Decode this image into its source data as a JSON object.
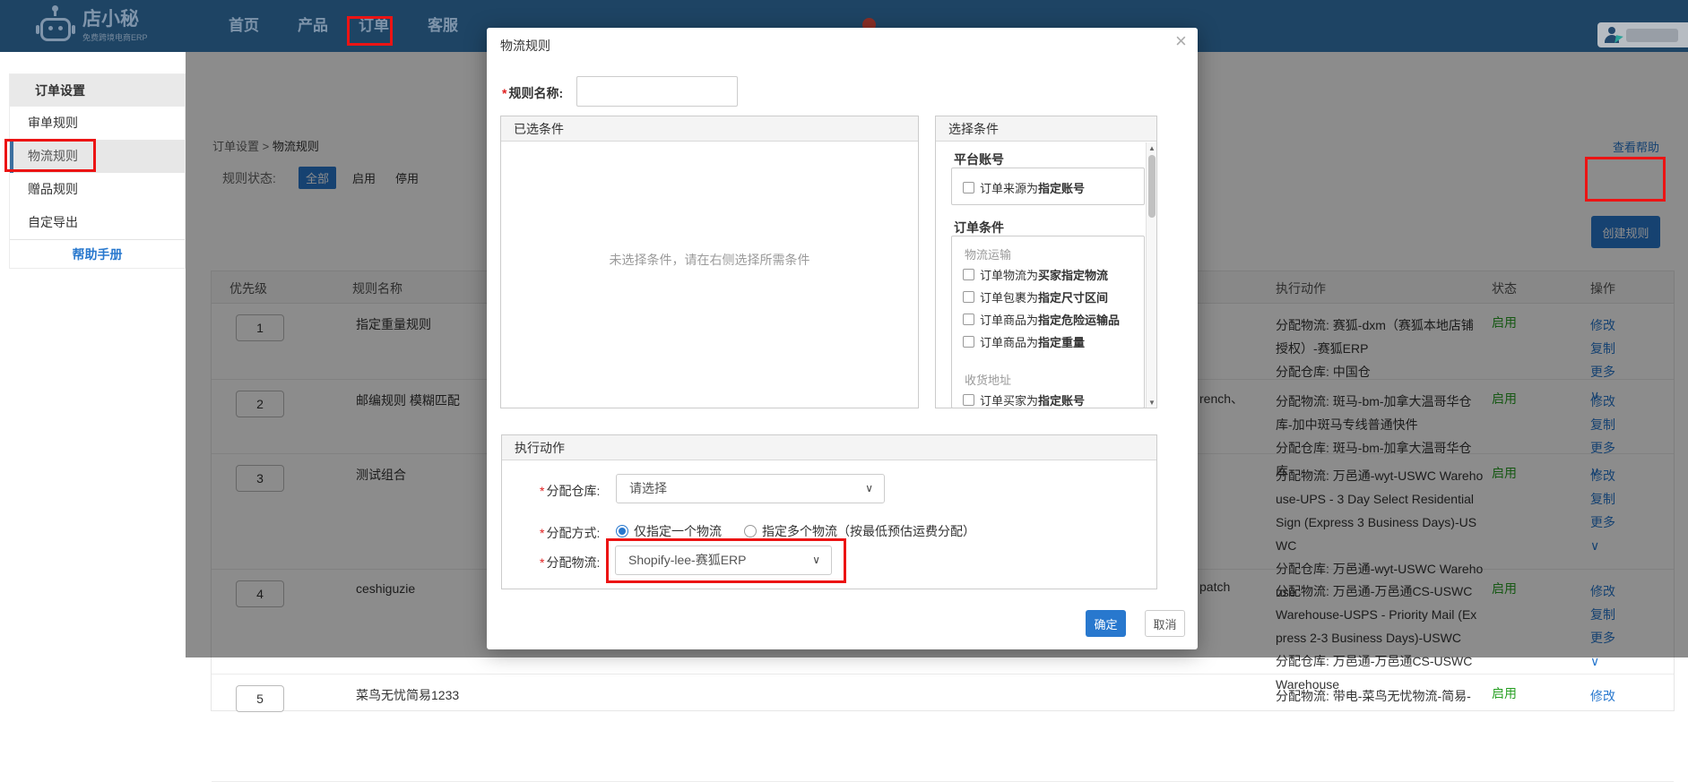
{
  "nav": {
    "logo_title": "店小秘",
    "logo_subtitle": "免费跨境电商ERP",
    "items": [
      "首页",
      "产品",
      "订单",
      "客服"
    ]
  },
  "sidebar": {
    "title": "订单设置",
    "items": [
      "审单规则",
      "物流规则",
      "赠品规则",
      "自定导出"
    ],
    "help_link": "帮助手册"
  },
  "content": {
    "breadcrumb": {
      "parent": "订单设置",
      "separator": ">",
      "current": "物流规则"
    },
    "help_link": "查看帮助",
    "filter": {
      "label": "规则状态:",
      "options": [
        "全部",
        "启用",
        "停用"
      ]
    },
    "create_button": "创建规则",
    "table": {
      "headers": [
        "优先级",
        "规则名称",
        "执行动作",
        "状态",
        "操作"
      ],
      "op_labels": {
        "edit": "修改",
        "copy": "复制",
        "more": "更多",
        "more_chevron": "∨"
      },
      "rows": [
        {
          "priority": "1",
          "name": "指定重量规则",
          "fragment": "",
          "action": "分配物流: 赛狐-dxm（赛狐本地店铺授权）-赛狐ERP\n分配仓库: 中国仓",
          "status": "启用"
        },
        {
          "priority": "2",
          "name": "邮编规则 模糊匹配",
          "fragment": "rench、",
          "action": "分配物流: 斑马-bm-加拿大温哥华仓库-加中斑马专线普通快件\n分配仓库: 斑马-bm-加拿大温哥华仓库",
          "status": "启用"
        },
        {
          "priority": "3",
          "name": "测试组合",
          "fragment": "",
          "action": "分配物流: 万邑通-wyt-USWC Warehouse-UPS - 3 Day Select Residential Sign (Express 3 Business Days)-USWC\n分配仓库: 万邑通-wyt-USWC Warehouse",
          "status": "启用"
        },
        {
          "priority": "4",
          "name": "ceshiguzie",
          "fragment": "patch",
          "action": "分配物流: 万邑通-万邑通CS-USWC Warehouse-USPS - Priority Mail (Express 2-3 Business Days)-USWC\n分配仓库: 万邑通-万邑通CS-USWC Warehouse",
          "status": "启用"
        },
        {
          "priority": "5",
          "name": "菜鸟无忧简易1233",
          "fragment": "",
          "action": "分配物流: 带电-菜鸟无忧物流-简易-",
          "status": "启用"
        }
      ]
    }
  },
  "modal": {
    "title": "物流规则",
    "close": "×",
    "rule_name_label": "规则名称:",
    "rule_name_value": "",
    "selected_panel": {
      "title": "已选条件",
      "placeholder": "未选择条件，请在右侧选择所需条件"
    },
    "choose_panel": {
      "title": "选择条件",
      "group1": {
        "heading": "平台账号",
        "item": {
          "pre": "订单来源为",
          "em": "指定账号"
        }
      },
      "group2": {
        "heading": "订单条件",
        "sub1": "物流运输",
        "sub1_items": [
          {
            "pre": "订单物流为",
            "em": "买家指定物流"
          },
          {
            "pre": "订单包裹为",
            "em": "指定尺寸区间"
          },
          {
            "pre": "订单商品为",
            "em": "指定危险运输品"
          },
          {
            "pre": "订单商品为",
            "em": "指定重量"
          }
        ],
        "sub2": "收货地址",
        "sub2_items": [
          {
            "pre": "订单买家为",
            "em": "指定账号"
          }
        ]
      }
    },
    "action_panel": {
      "title": "执行动作",
      "warehouse_label": "分配仓库:",
      "warehouse_value": "请选择",
      "method_label": "分配方式:",
      "method_option1": "仅指定一个物流",
      "method_option2": "指定多个物流（按最低预估运费分配）",
      "logistics_label": "分配物流:",
      "logistics_value": "Shopify-lee-赛狐ERP",
      "chevron": "∨"
    },
    "footer": {
      "ok": "确定",
      "cancel": "取消"
    }
  },
  "colors": {
    "nav_bg": "#1e4464",
    "accent_blue": "#2878ce",
    "success_green": "#28a024",
    "annotation_red": "#ec1414",
    "notification_dot": "#8b2e26"
  }
}
